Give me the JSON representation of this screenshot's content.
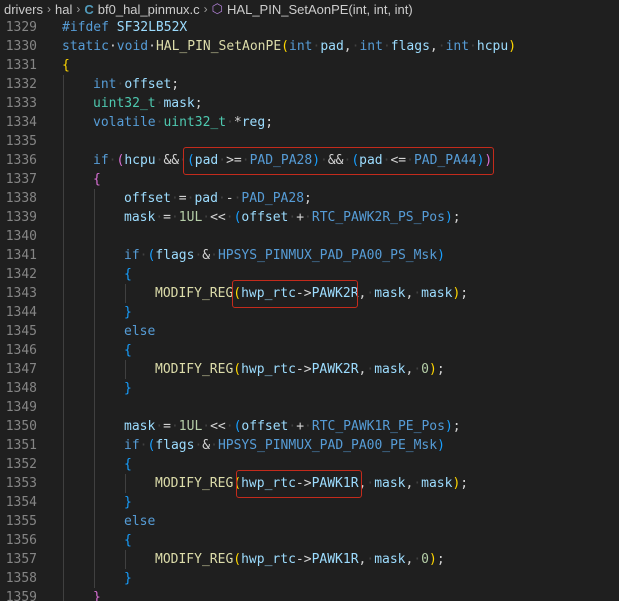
{
  "breadcrumb": {
    "items": [
      "drivers",
      "hal",
      "bf0_hal_pinmux.c",
      "HAL_PIN_SetAonPE(int, int, int)"
    ],
    "file_icon": "C",
    "symbol_icon": "method-cube-icon"
  },
  "editor": {
    "lines": [
      {
        "n": "1329",
        "indent": 0,
        "t": [
          [
            "pp",
            "#ifdef"
          ],
          [
            "ws",
            " "
          ],
          [
            "var",
            "SF32LB52X"
          ]
        ]
      },
      {
        "n": "1330",
        "indent": 0,
        "t": [
          [
            "kw",
            "static"
          ],
          [
            "",
            "·"
          ],
          [
            "kw",
            "void"
          ],
          [
            "",
            "·"
          ],
          [
            "fn",
            "HAL_PIN_SetAonPE"
          ],
          [
            "b1",
            "("
          ],
          [
            "kw",
            "int"
          ],
          [
            "ws",
            "·"
          ],
          [
            "var",
            "pad"
          ],
          [
            "",
            ","
          ],
          [
            "ws",
            "·"
          ],
          [
            "kw",
            "int"
          ],
          [
            "ws",
            "·"
          ],
          [
            "var",
            "flags"
          ],
          [
            "",
            ","
          ],
          [
            "ws",
            "·"
          ],
          [
            "kw",
            "int"
          ],
          [
            "ws",
            "·"
          ],
          [
            "var",
            "hcpu"
          ],
          [
            "b1",
            ")"
          ]
        ]
      },
      {
        "n": "1331",
        "indent": 0,
        "t": [
          [
            "b1",
            "{"
          ]
        ]
      },
      {
        "n": "1332",
        "indent": 1,
        "t": [
          [
            "kw",
            "int"
          ],
          [
            "ws",
            "·"
          ],
          [
            "var",
            "offset"
          ],
          [
            "",
            ";"
          ]
        ]
      },
      {
        "n": "1333",
        "indent": 1,
        "t": [
          [
            "ty",
            "uint32_t"
          ],
          [
            "ws",
            "·"
          ],
          [
            "var",
            "mask"
          ],
          [
            "",
            ";"
          ]
        ]
      },
      {
        "n": "1334",
        "indent": 1,
        "t": [
          [
            "kw",
            "volatile"
          ],
          [
            "ws",
            "·"
          ],
          [
            "ty",
            "uint32_t"
          ],
          [
            "ws",
            "·"
          ],
          [
            "",
            "*"
          ],
          [
            "var",
            "reg"
          ],
          [
            "",
            ";"
          ]
        ]
      },
      {
        "n": "1335",
        "indent": 1,
        "t": []
      },
      {
        "n": "1336",
        "indent": 1,
        "t": [
          [
            "kw",
            "if"
          ],
          [
            "ws",
            "·"
          ],
          [
            "b2",
            "("
          ],
          [
            "var",
            "hcpu"
          ],
          [
            "ws",
            "·"
          ],
          [
            "",
            "&&"
          ],
          [
            "ws",
            "·"
          ],
          [
            "b3",
            "("
          ],
          [
            "var",
            "pad"
          ],
          [
            "ws",
            "·"
          ],
          [
            "",
            ">="
          ],
          [
            "ws",
            "·"
          ],
          [
            "mac",
            "PAD_PA28"
          ],
          [
            "b3",
            ")"
          ],
          [
            "ws",
            "·"
          ],
          [
            "",
            "&&"
          ],
          [
            "ws",
            "·"
          ],
          [
            "b3",
            "("
          ],
          [
            "var",
            "pad"
          ],
          [
            "ws",
            "·"
          ],
          [
            "",
            "<="
          ],
          [
            "ws",
            "·"
          ],
          [
            "mac",
            "PAD_PA44"
          ],
          [
            "b3",
            ")"
          ],
          [
            "b2",
            ")"
          ]
        ]
      },
      {
        "n": "1337",
        "indent": 1,
        "t": [
          [
            "b2",
            "{"
          ]
        ]
      },
      {
        "n": "1338",
        "indent": 2,
        "t": [
          [
            "var",
            "offset"
          ],
          [
            "ws",
            "·"
          ],
          [
            "",
            "="
          ],
          [
            "ws",
            "·"
          ],
          [
            "var",
            "pad"
          ],
          [
            "ws",
            "·"
          ],
          [
            "",
            "-"
          ],
          [
            "ws",
            "·"
          ],
          [
            "mac",
            "PAD_PA28"
          ],
          [
            "",
            ";"
          ]
        ]
      },
      {
        "n": "1339",
        "indent": 2,
        "t": [
          [
            "var",
            "mask"
          ],
          [
            "ws",
            "·"
          ],
          [
            "",
            "="
          ],
          [
            "ws",
            "·"
          ],
          [
            "num",
            "1UL"
          ],
          [
            "ws",
            "·"
          ],
          [
            "",
            "<<"
          ],
          [
            "ws",
            "·"
          ],
          [
            "b3",
            "("
          ],
          [
            "var",
            "offset"
          ],
          [
            "ws",
            "·"
          ],
          [
            "",
            "+"
          ],
          [
            "ws",
            "·"
          ],
          [
            "mac",
            "RTC_PAWK2R_PS_Pos"
          ],
          [
            "b3",
            ")"
          ],
          [
            "",
            ";"
          ]
        ]
      },
      {
        "n": "1340",
        "indent": 2,
        "t": []
      },
      {
        "n": "1341",
        "indent": 2,
        "t": [
          [
            "kw",
            "if"
          ],
          [
            "ws",
            "·"
          ],
          [
            "b3",
            "("
          ],
          [
            "var",
            "flags"
          ],
          [
            "ws",
            "·"
          ],
          [
            "",
            "&"
          ],
          [
            "ws",
            "·"
          ],
          [
            "mac",
            "HPSYS_PINMUX_PAD_PA00_PS_Msk"
          ],
          [
            "b3",
            ")"
          ]
        ]
      },
      {
        "n": "1342",
        "indent": 2,
        "t": [
          [
            "b3",
            "{"
          ]
        ]
      },
      {
        "n": "1343",
        "indent": 3,
        "t": [
          [
            "fn",
            "MODIFY_REG"
          ],
          [
            "b1",
            "("
          ],
          [
            "var",
            "hwp_rtc"
          ],
          [
            "",
            "->"
          ],
          [
            "var",
            "PAWK2R"
          ],
          [
            "",
            ","
          ],
          [
            "ws",
            "·"
          ],
          [
            "var",
            "mask"
          ],
          [
            "",
            ","
          ],
          [
            "ws",
            "·"
          ],
          [
            "var",
            "mask"
          ],
          [
            "b1",
            ")"
          ],
          [
            "",
            ";"
          ]
        ]
      },
      {
        "n": "1344",
        "indent": 2,
        "t": [
          [
            "b3",
            "}"
          ]
        ]
      },
      {
        "n": "1345",
        "indent": 2,
        "t": [
          [
            "kw",
            "else"
          ]
        ]
      },
      {
        "n": "1346",
        "indent": 2,
        "t": [
          [
            "b3",
            "{"
          ]
        ]
      },
      {
        "n": "1347",
        "indent": 3,
        "t": [
          [
            "fn",
            "MODIFY_REG"
          ],
          [
            "b1",
            "("
          ],
          [
            "var",
            "hwp_rtc"
          ],
          [
            "",
            "->"
          ],
          [
            "var",
            "PAWK2R"
          ],
          [
            "",
            ","
          ],
          [
            "ws",
            "·"
          ],
          [
            "var",
            "mask"
          ],
          [
            "",
            ","
          ],
          [
            "ws",
            "·"
          ],
          [
            "num",
            "0"
          ],
          [
            "b1",
            ")"
          ],
          [
            "",
            ";"
          ]
        ]
      },
      {
        "n": "1348",
        "indent": 2,
        "t": [
          [
            "b3",
            "}"
          ]
        ]
      },
      {
        "n": "1349",
        "indent": 2,
        "t": []
      },
      {
        "n": "1350",
        "indent": 2,
        "t": [
          [
            "var",
            "mask"
          ],
          [
            "ws",
            "·"
          ],
          [
            "",
            "="
          ],
          [
            "ws",
            "·"
          ],
          [
            "num",
            "1UL"
          ],
          [
            "ws",
            "·"
          ],
          [
            "",
            "<<"
          ],
          [
            "ws",
            "·"
          ],
          [
            "b3",
            "("
          ],
          [
            "var",
            "offset"
          ],
          [
            "ws",
            "·"
          ],
          [
            "",
            "+"
          ],
          [
            "ws",
            "·"
          ],
          [
            "mac",
            "RTC_PAWK1R_PE_Pos"
          ],
          [
            "b3",
            ")"
          ],
          [
            "",
            ";"
          ]
        ]
      },
      {
        "n": "1351",
        "indent": 2,
        "t": [
          [
            "kw",
            "if"
          ],
          [
            "ws",
            "·"
          ],
          [
            "b3",
            "("
          ],
          [
            "var",
            "flags"
          ],
          [
            "ws",
            "·"
          ],
          [
            "",
            "&"
          ],
          [
            "ws",
            "·"
          ],
          [
            "mac",
            "HPSYS_PINMUX_PAD_PA00_PE_Msk"
          ],
          [
            "b3",
            ")"
          ]
        ]
      },
      {
        "n": "1352",
        "indent": 2,
        "t": [
          [
            "b3",
            "{"
          ]
        ]
      },
      {
        "n": "1353",
        "indent": 3,
        "t": [
          [
            "fn",
            "MODIFY_REG"
          ],
          [
            "b1",
            "("
          ],
          [
            "var",
            "hwp_rtc"
          ],
          [
            "",
            "->"
          ],
          [
            "var",
            "PAWK1R"
          ],
          [
            "",
            ","
          ],
          [
            "ws",
            "·"
          ],
          [
            "var",
            "mask"
          ],
          [
            "",
            ","
          ],
          [
            "ws",
            "·"
          ],
          [
            "var",
            "mask"
          ],
          [
            "b1",
            ")"
          ],
          [
            "",
            ";"
          ]
        ]
      },
      {
        "n": "1354",
        "indent": 2,
        "t": [
          [
            "b3",
            "}"
          ]
        ]
      },
      {
        "n": "1355",
        "indent": 2,
        "t": [
          [
            "kw",
            "else"
          ]
        ]
      },
      {
        "n": "1356",
        "indent": 2,
        "t": [
          [
            "b3",
            "{"
          ]
        ]
      },
      {
        "n": "1357",
        "indent": 3,
        "t": [
          [
            "fn",
            "MODIFY_REG"
          ],
          [
            "b1",
            "("
          ],
          [
            "var",
            "hwp_rtc"
          ],
          [
            "",
            "->"
          ],
          [
            "var",
            "PAWK1R"
          ],
          [
            "",
            ","
          ],
          [
            "ws",
            "·"
          ],
          [
            "var",
            "mask"
          ],
          [
            "",
            ","
          ],
          [
            "ws",
            "·"
          ],
          [
            "num",
            "0"
          ],
          [
            "b1",
            ")"
          ],
          [
            "",
            ";"
          ]
        ]
      },
      {
        "n": "1358",
        "indent": 2,
        "t": [
          [
            "b3",
            "}"
          ]
        ]
      },
      {
        "n": "1359",
        "indent": 1,
        "t": [
          [
            "b2",
            "}"
          ]
        ]
      }
    ]
  },
  "colors": {
    "background": "#1f1f1f",
    "highlight_box": "#c42b1c",
    "keyword": "#569cd6",
    "function": "#dcdcaa",
    "variable": "#9cdcfe"
  }
}
